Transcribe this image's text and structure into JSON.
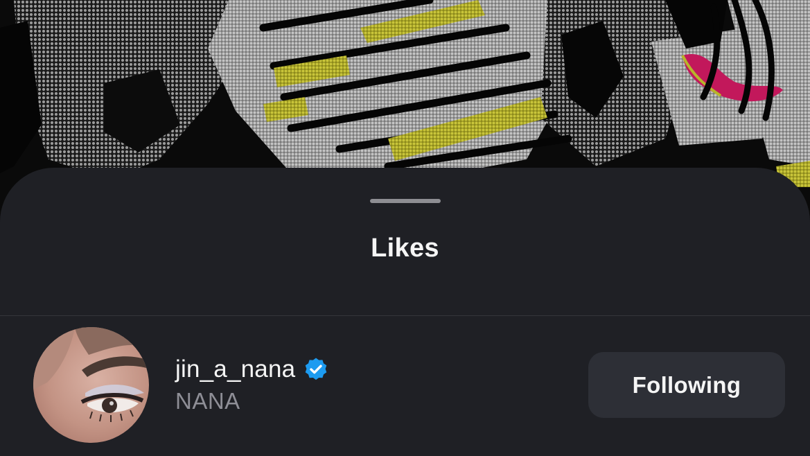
{
  "sheet": {
    "title": "Likes"
  },
  "likes": [
    {
      "username": "jin_a_nana",
      "display_name": "NANA",
      "verified": true,
      "button_label": "Following"
    }
  ],
  "icons": {
    "verified": "verified-badge-icon",
    "grabber": "drag-handle"
  },
  "colors": {
    "sheet_background": "#1f2025",
    "button_background": "#2d2f36",
    "verified_blue": "#1d9bf0",
    "secondary_text": "#8e8e96",
    "art_yellow": "#b8b42a",
    "art_magenta": "#c2185b"
  }
}
